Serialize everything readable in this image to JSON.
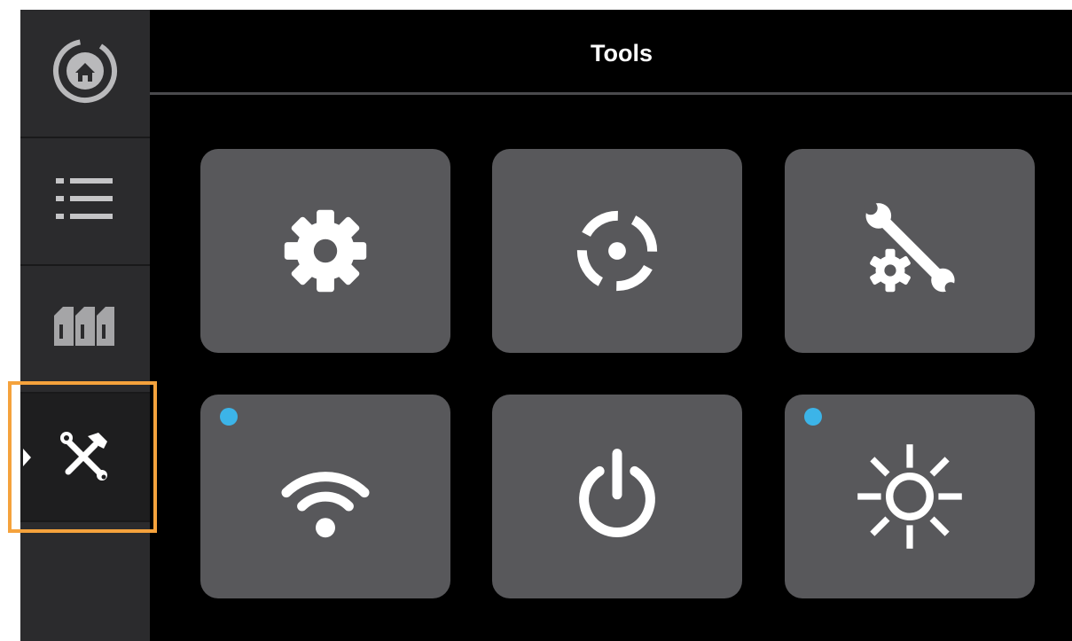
{
  "header": {
    "title": "Tools"
  },
  "sidebar": {
    "items": [
      {
        "name": "home",
        "icon": "home-icon",
        "active": false
      },
      {
        "name": "list",
        "icon": "list-icon",
        "active": false
      },
      {
        "name": "materials",
        "icon": "material-spools-icon",
        "active": false
      },
      {
        "name": "tools",
        "icon": "tools-icon",
        "active": true
      }
    ]
  },
  "tiles": [
    {
      "name": "settings",
      "icon": "gear-icon",
      "indicator": false
    },
    {
      "name": "calibrate",
      "icon": "target-icon",
      "indicator": false
    },
    {
      "name": "maintenance",
      "icon": "wrench-gear-icon",
      "indicator": false
    },
    {
      "name": "network",
      "icon": "wifi-icon",
      "indicator": true
    },
    {
      "name": "power",
      "icon": "power-icon",
      "indicator": false
    },
    {
      "name": "brightness",
      "icon": "brightness-icon",
      "indicator": true
    }
  ],
  "colors": {
    "screen_background": "#000000",
    "sidebar_background": "#2b2b2d",
    "tile_background": "#58585b",
    "indicator_dot": "#3cb4e8",
    "highlight_outline": "#f5a23c",
    "icon": "#ffffff"
  }
}
